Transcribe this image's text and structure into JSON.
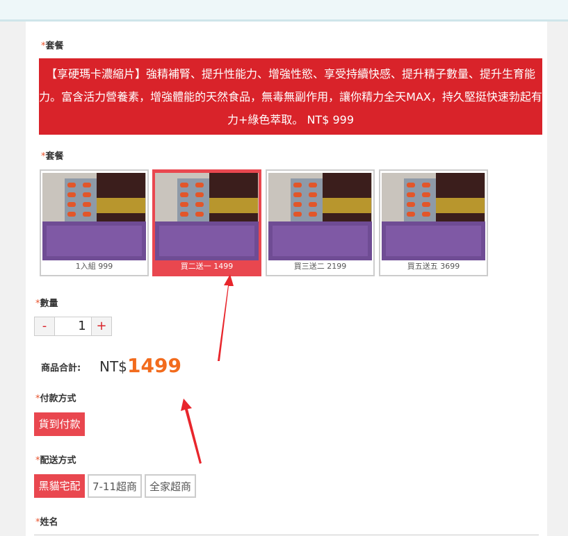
{
  "form": {
    "required_mark": "*",
    "package_label_1": "套餐",
    "banner_text": "【享硬瑪卡濃縮片】強精補腎、提升性能力、增強性慾、享受持續快感、提升精子數量、提升生育能力。富含活力營養素，增強體能的天然食品，無毒無副作用，讓你精力全天MAX，持久堅挺快速勃起有力+綠色萃取。 NT$ 999",
    "package_label_2": "套餐",
    "packages": [
      {
        "caption": "1入組 999",
        "selected": false
      },
      {
        "caption": "買二送一 1499",
        "selected": true
      },
      {
        "caption": "買三送二 2199",
        "selected": false
      },
      {
        "caption": "買五送五 3699",
        "selected": false
      }
    ],
    "quantity_label": "數量",
    "quantity": {
      "minus": "-",
      "value": "1",
      "plus": "+"
    },
    "total_label": "商品合計:",
    "total_currency": "NT$",
    "total_amount": "1499",
    "payment_label": "付款方式",
    "payment_options": [
      "貨到付款"
    ],
    "shipping_label": "配送方式",
    "shipping_options": [
      "黑貓宅配",
      "7-11超商",
      "全家超商"
    ],
    "name_label": "姓名"
  },
  "colors": {
    "accent": "#e9474f",
    "banner": "#d9232a",
    "price": "#f26b1d"
  }
}
